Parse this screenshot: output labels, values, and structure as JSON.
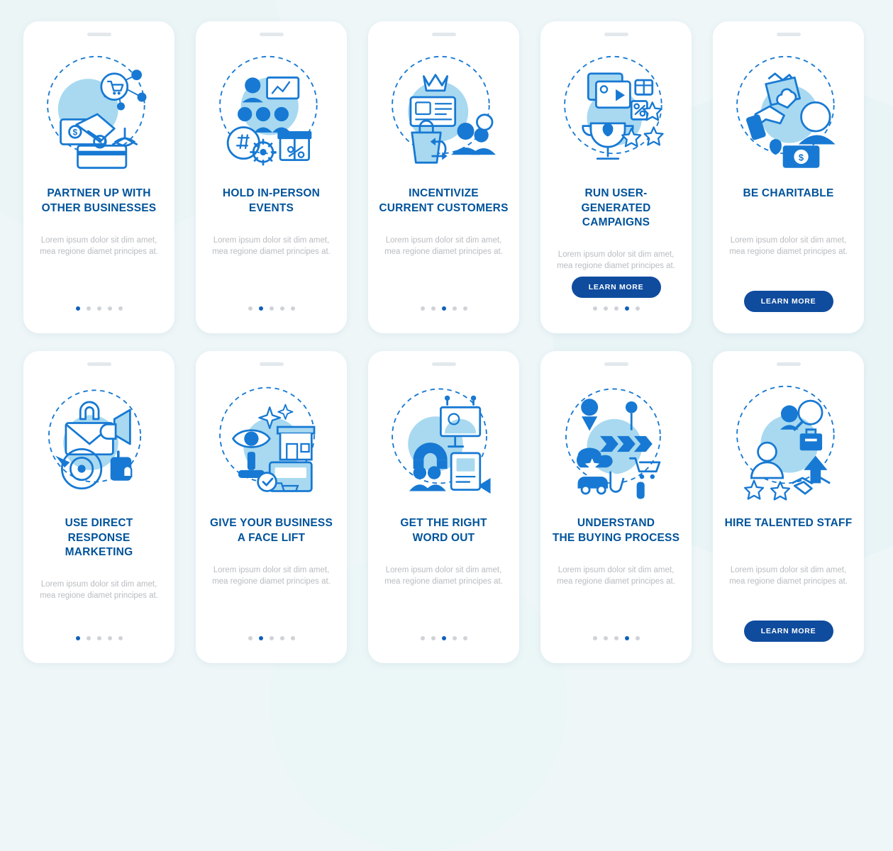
{
  "theme": {
    "background": "#eef6f8",
    "card_background": "#ffffff",
    "title_color": "#00539b",
    "body_color": "#b9bcc0",
    "accent_color": "#1060b8",
    "button_color": "#0f4c9e",
    "icon_line_color": "#1779d3",
    "icon_fill_color": "#a8d9f0"
  },
  "cards": [
    {
      "icon_name": "handshake-dollar-network-icon",
      "title": "PARTNER UP WITH\nOTHER BUSINESSES",
      "body": "Lorem ipsum dolor sit dim amet, mea regione diamet principes at.",
      "dots": 5,
      "active_dot": 0,
      "button": null
    },
    {
      "icon_name": "people-presentation-hashtag-gift-icon",
      "title": "HOLD IN-PERSON\nEVENTS",
      "body": "Lorem ipsum dolor sit dim amet, mea regione diamet principes at.",
      "dots": 5,
      "active_dot": 1,
      "button": null
    },
    {
      "icon_name": "loyalty-card-crown-shopping-icon",
      "title": "INCENTIVIZE\nCURRENT CUSTOMERS",
      "body": "Lorem ipsum dolor sit dim amet, mea regione diamet principes at.",
      "dots": 5,
      "active_dot": 2,
      "button": null
    },
    {
      "icon_name": "trophy-video-stars-percent-icon",
      "title": "RUN USER-GENERATED\nCAMPAIGNS",
      "body": "Lorem ipsum dolor sit dim amet, mea regione diamet principes at.",
      "dots": 5,
      "active_dot": 3,
      "button": "LEARN MORE"
    },
    {
      "icon_name": "charity-hands-heart-money-icon",
      "title": "BE CHARITABLE",
      "body": "Lorem ipsum dolor sit dim amet, mea regione diamet principes at.",
      "dots": 0,
      "active_dot": -1,
      "button": "LEARN MORE"
    },
    {
      "icon_name": "email-megaphone-target-click-icon",
      "title": "USE DIRECT\nRESPONSE MARKETING",
      "body": "Lorem ipsum dolor sit dim amet, mea regione diamet principes at.",
      "dots": 5,
      "active_dot": 0,
      "button": null
    },
    {
      "icon_name": "storefront-eye-rebrand-icon",
      "title": "GIVE YOUR BUSINESS\nA FACE LIFT",
      "body": "Lorem ipsum dolor sit dim amet, mea regione diamet principes at.",
      "dots": 5,
      "active_dot": 1,
      "button": null
    },
    {
      "icon_name": "billboard-magnet-audience-icon",
      "title": "GET THE RIGHT\nWORD OUT",
      "body": "Lorem ipsum dolor sit dim amet, mea regione diamet principes at.",
      "dots": 5,
      "active_dot": 2,
      "button": null
    },
    {
      "icon_name": "buying-process-cart-funnel-icon",
      "title": "UNDERSTAND\nTHE BUYING PROCESS",
      "body": "Lorem ipsum dolor sit dim amet, mea regione diamet principes at.",
      "dots": 5,
      "active_dot": 3,
      "button": null
    },
    {
      "icon_name": "hiring-staff-search-handshake-icon",
      "title": "HIRE TALENTED STAFF",
      "body": "Lorem ipsum dolor sit dim amet, mea regione diamet principes at.",
      "dots": 0,
      "active_dot": -1,
      "button": "LEARN MORE"
    }
  ]
}
